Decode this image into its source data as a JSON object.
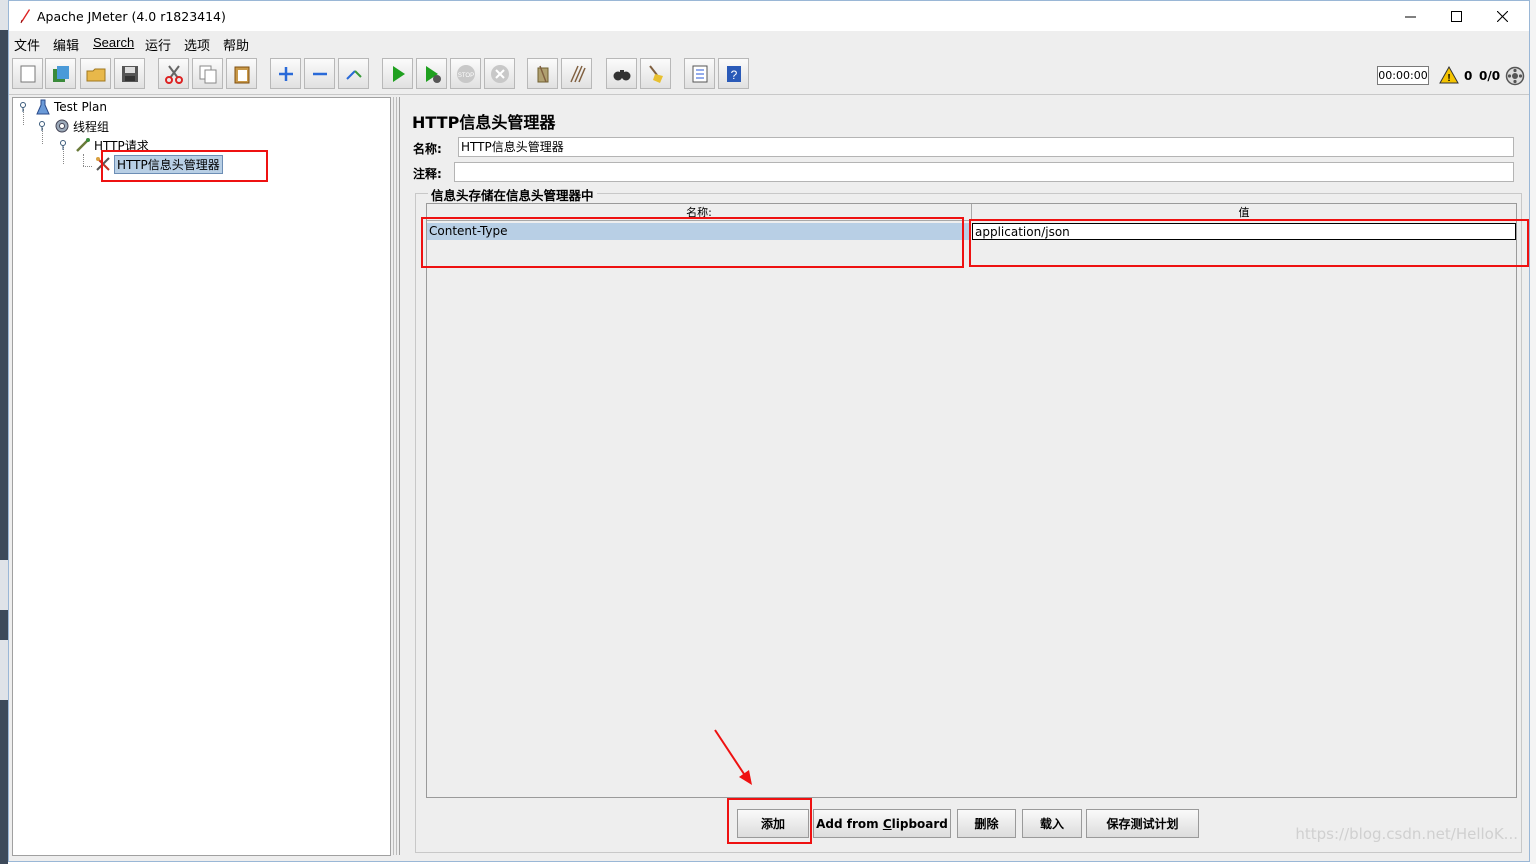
{
  "window": {
    "title": "Apache JMeter (4.0 r1823414)",
    "minimize_icon": "minimize-icon",
    "maximize_icon": "maximize-icon",
    "close_icon": "close-icon"
  },
  "menubar": {
    "items": [
      "文件",
      "编辑",
      "Search",
      "运行",
      "选项",
      "帮助"
    ]
  },
  "toolbar": {
    "timer": "00:00:00",
    "warning_count": "0",
    "thread_count": "0/0",
    "icons": [
      "new-icon",
      "templates-icon",
      "open-icon",
      "save-icon",
      "cut-icon",
      "copy-icon",
      "paste-icon",
      "expand-icon",
      "collapse-icon",
      "toggle-icon",
      "start-icon",
      "start-no-pause-icon",
      "stop-icon",
      "shutdown-icon",
      "clear-icon",
      "clear-all-icon",
      "search-icon",
      "reset-search-icon",
      "function-helper-icon",
      "help-icon"
    ]
  },
  "tree": {
    "nodes": [
      {
        "label": "Test Plan",
        "icon": "test-plan-icon"
      },
      {
        "label": "线程组",
        "icon": "thread-group-icon"
      },
      {
        "label": "HTTP请求",
        "icon": "http-sampler-icon"
      },
      {
        "label": "HTTP信息头管理器",
        "icon": "header-manager-icon"
      }
    ]
  },
  "panel": {
    "title": "HTTP信息头管理器",
    "name_label": "名称:",
    "name_value": "HTTP信息头管理器",
    "comment_label": "注释:",
    "comment_value": "",
    "group_title": "信息头存储在信息头管理器中",
    "table": {
      "columns": [
        "名称:",
        "值"
      ],
      "rows": [
        {
          "name": "Content-Type",
          "value": "application/json"
        }
      ]
    },
    "buttons": {
      "add": "添加",
      "add_from_clipboard_prefix": "Add from ",
      "add_from_clipboard_mnemonic": "C",
      "add_from_clipboard_suffix": "lipboard",
      "delete": "删除",
      "load": "载入",
      "save": "保存测试计划"
    }
  },
  "watermark": "https://blog.csdn.net/HelloK..."
}
